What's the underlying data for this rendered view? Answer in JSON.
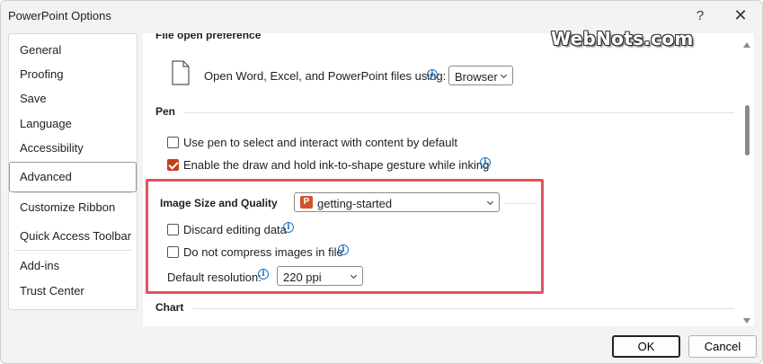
{
  "window": {
    "title": "PowerPoint Options",
    "help_glyph": "?",
    "close_glyph": "✕"
  },
  "sidebar": {
    "items": [
      {
        "label": "General"
      },
      {
        "label": "Proofing"
      },
      {
        "label": "Save"
      },
      {
        "label": "Language"
      },
      {
        "label": "Accessibility"
      },
      {
        "label": "Advanced",
        "selected": true
      },
      {
        "label": "Customize Ribbon"
      },
      {
        "label": "Quick Access Toolbar"
      },
      {
        "label": "Add-ins"
      },
      {
        "label": "Trust Center"
      }
    ]
  },
  "content": {
    "file_open": {
      "heading": "File open preference",
      "label": "Open Word, Excel, and PowerPoint files using:",
      "dropdown_value": "Browser"
    },
    "pen": {
      "heading": "Pen",
      "option1": {
        "label": "Use pen to select and interact with content by default",
        "checked": false
      },
      "option2": {
        "label": "Enable the draw and hold ink-to-shape gesture while inking",
        "checked": true
      }
    },
    "image_size": {
      "heading": "Image Size and Quality",
      "file_dropdown_value": "getting-started",
      "discard": {
        "label": "Discard editing data",
        "checked": false
      },
      "no_compress": {
        "label": "Do not compress images in file",
        "checked": false
      },
      "resolution_label": "Default resolution:",
      "resolution_value": "220 ppi"
    },
    "chart": {
      "heading": "Chart"
    }
  },
  "watermark": "WebNots.com",
  "footer": {
    "ok_label": "OK",
    "cancel_label": "Cancel"
  },
  "colors": {
    "accent_checkbox": "#c43e1c",
    "highlight_box": "#e0535b",
    "info_icon": "#1a73c8"
  }
}
